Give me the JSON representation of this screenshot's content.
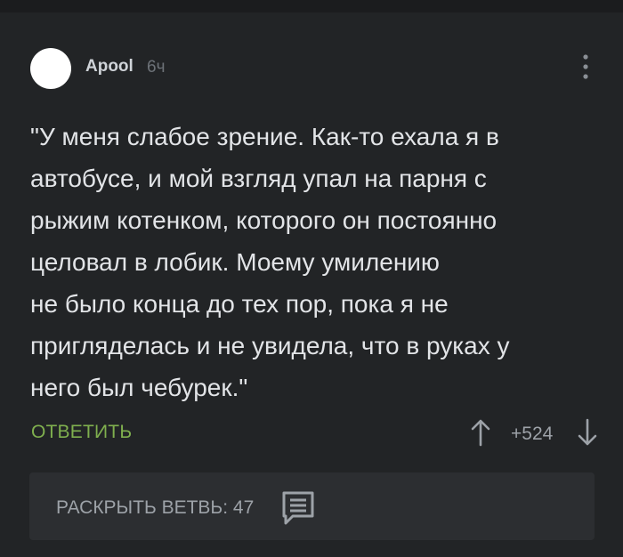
{
  "comment": {
    "author": "Apool",
    "time": "6ч",
    "text_lines": [
      "\"У меня слабое зрение. Как-то ехала я в",
      "автобусе, и мой взгляд упал на парня с",
      "рыжим котенком, которого он постоянно",
      "целовал в лобик. Моему умилению",
      "не было конца до тех пор, пока я не",
      "пригляделась и не увидела, что в руках у",
      "него был чебурек.\""
    ],
    "reply_label": "ОТВЕТИТЬ",
    "rating": "+524"
  },
  "thread": {
    "expand_label": "РАСКРЫТЬ ВЕТВЬ: 47"
  },
  "icons": {
    "more": "more-vertical-icon",
    "upvote": "arrow-up-icon",
    "downvote": "arrow-down-icon",
    "comments": "comments-icon"
  },
  "colors": {
    "background": "#222426",
    "reply_accent": "#7faf4e",
    "panel": "#2c2e31"
  }
}
